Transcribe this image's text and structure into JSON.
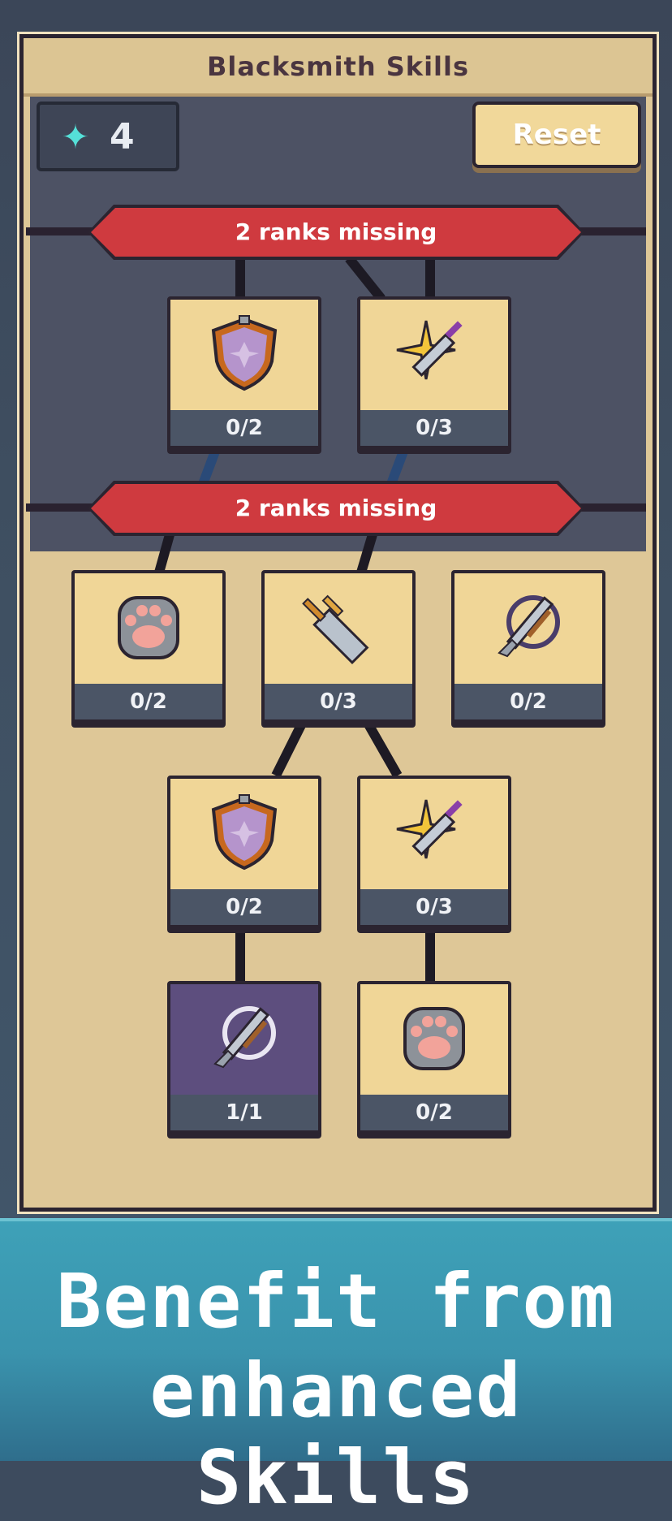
{
  "panel": {
    "title": "Blacksmith Skills"
  },
  "resources": {
    "gem_icon": "diamond-icon",
    "gem_count": "4",
    "gem_color": "#55e0d8"
  },
  "toolbar": {
    "reset_label": "Reset"
  },
  "tiers": [
    {
      "lock_label": "2 ranks missing"
    },
    {
      "lock_label": "2 ranks missing"
    }
  ],
  "nodes": [
    {
      "icon": "shield-icon",
      "rank": "0/2"
    },
    {
      "icon": "sword-spark-icon",
      "rank": "0/3"
    },
    {
      "icon": "paw-icon",
      "rank": "0/2"
    },
    {
      "icon": "broadsword-icon",
      "rank": "0/3"
    },
    {
      "icon": "hook-sword-icon",
      "rank": "0/2"
    },
    {
      "icon": "shield-icon",
      "rank": "0/2"
    },
    {
      "icon": "sword-spark-icon",
      "rank": "0/3"
    },
    {
      "icon": "hook-sword-icon",
      "rank": "1/1"
    },
    {
      "icon": "paw-icon",
      "rank": "0/2"
    }
  ],
  "tagline": {
    "line1": "Benefit from",
    "line2": "enhanced Skills"
  },
  "colors": {
    "banner": "#cf3a3f",
    "node_bg": "#f0d697",
    "maxed_node_bg": "#5d4e7e",
    "accent": "#3ea1b8"
  }
}
